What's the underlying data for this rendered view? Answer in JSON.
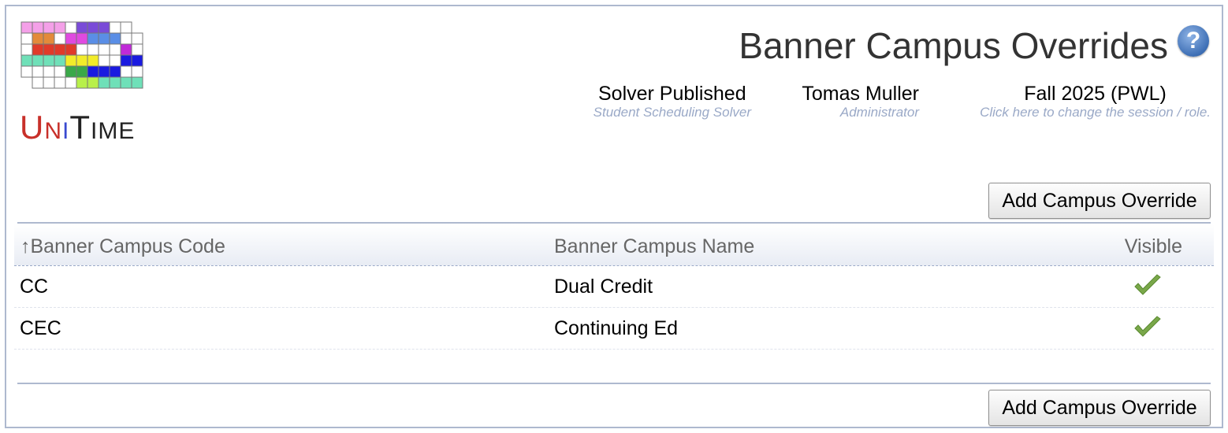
{
  "logo": {
    "text": "UniTime"
  },
  "header": {
    "page_title": "Banner Campus Overrides",
    "help_icon": "?",
    "solver": {
      "value": "Solver Published",
      "label": "Student Scheduling Solver"
    },
    "user": {
      "value": "Tomas Muller",
      "label": "Administrator"
    },
    "session": {
      "value": "Fall 2025 (PWL)",
      "label": "Click here to change the session / role."
    }
  },
  "buttons": {
    "add_override_top": "Add Campus Override",
    "add_override_bottom": "Add Campus Override"
  },
  "table": {
    "columns": {
      "code": "↑Banner Campus Code",
      "name": "Banner Campus Name",
      "visible": "Visible"
    },
    "rows": [
      {
        "code": "CC",
        "name": "Dual Credit",
        "visible": "check-icon"
      },
      {
        "code": "CEC",
        "name": "Continuing Ed",
        "visible": "check-icon"
      }
    ]
  },
  "colors": {
    "border": "#aeb9cf",
    "sublabel": "#9aa9c7",
    "check": "#7aa84a",
    "help": "#3e6fb5"
  }
}
